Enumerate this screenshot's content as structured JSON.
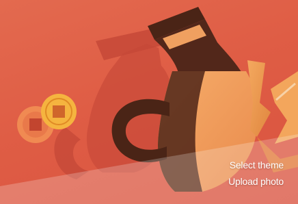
{
  "theme_banner": {
    "actions": {
      "select_theme_label": "Select theme",
      "upload_photo_label": "Upload photo"
    }
  },
  "colors": {
    "background": "#e0603f",
    "shadow_vase": "#c94b3a",
    "vase_dark": "#4a2416",
    "vase_light": "#f0a060",
    "coin": "#f5b43f",
    "overlay": "#ffffff"
  },
  "icons": {
    "illustration": "lunar-new-year-vase-and-coins-illustration"
  }
}
